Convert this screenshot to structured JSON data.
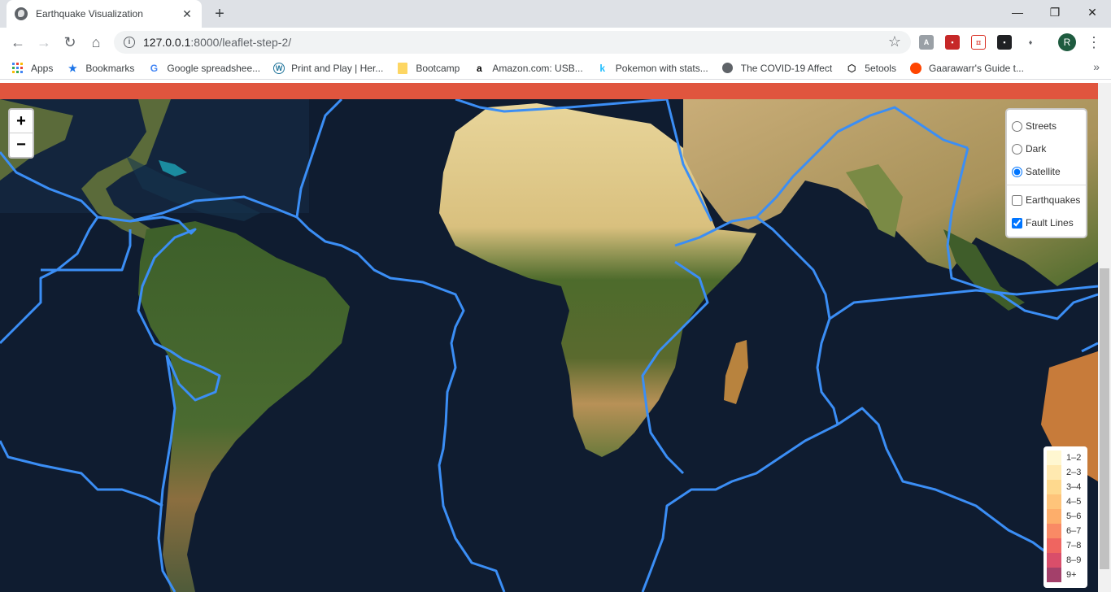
{
  "browser": {
    "tab_title": "Earthquake Visualization",
    "tab_close": "✕",
    "new_tab": "+",
    "url_host": "127.0.0.1",
    "url_path": ":8000/leaflet-step-2/",
    "window_controls": [
      "—",
      "❐",
      "✕"
    ],
    "profile_initial": "R"
  },
  "bookmarks": [
    {
      "label": "Apps",
      "icon": "apps-grid-icon"
    },
    {
      "label": "Bookmarks",
      "icon": "star-icon"
    },
    {
      "label": "Google spreadshee...",
      "icon": "google-icon"
    },
    {
      "label": "Print and Play | Her...",
      "icon": "wordpress-icon"
    },
    {
      "label": "Bootcamp",
      "icon": "folder-icon"
    },
    {
      "label": "Amazon.com: USB...",
      "icon": "amazon-icon"
    },
    {
      "label": "Pokemon with stats...",
      "icon": "kaggle-icon"
    },
    {
      "label": "The COVID-19 Affect",
      "icon": "globe-icon"
    },
    {
      "label": "5etools",
      "icon": "dice-icon"
    },
    {
      "label": "Gaarawarr's Guide t...",
      "icon": "reddit-icon"
    }
  ],
  "map": {
    "zoom_in": "+",
    "zoom_out": "−",
    "base_layers": [
      {
        "label": "Streets",
        "checked": false
      },
      {
        "label": "Dark",
        "checked": false
      },
      {
        "label": "Satellite",
        "checked": true
      }
    ],
    "overlays": [
      {
        "label": "Earthquakes",
        "checked": false
      },
      {
        "label": "Fault Lines",
        "checked": true
      }
    ],
    "legend": [
      {
        "label": "1–2",
        "color": "#fff7d1"
      },
      {
        "label": "2–3",
        "color": "#ffe9b0"
      },
      {
        "label": "3–4",
        "color": "#fed98e"
      },
      {
        "label": "4–5",
        "color": "#fec47a"
      },
      {
        "label": "5–6",
        "color": "#fdae6b"
      },
      {
        "label": "6–7",
        "color": "#f98a65"
      },
      {
        "label": "7–8",
        "color": "#ef6560"
      },
      {
        "label": "8–9",
        "color": "#d94e6a"
      },
      {
        "label": "9+",
        "color": "#a3406a"
      }
    ],
    "fault_line_color": "#3b8ef5",
    "banner_color": "#e0553e"
  }
}
